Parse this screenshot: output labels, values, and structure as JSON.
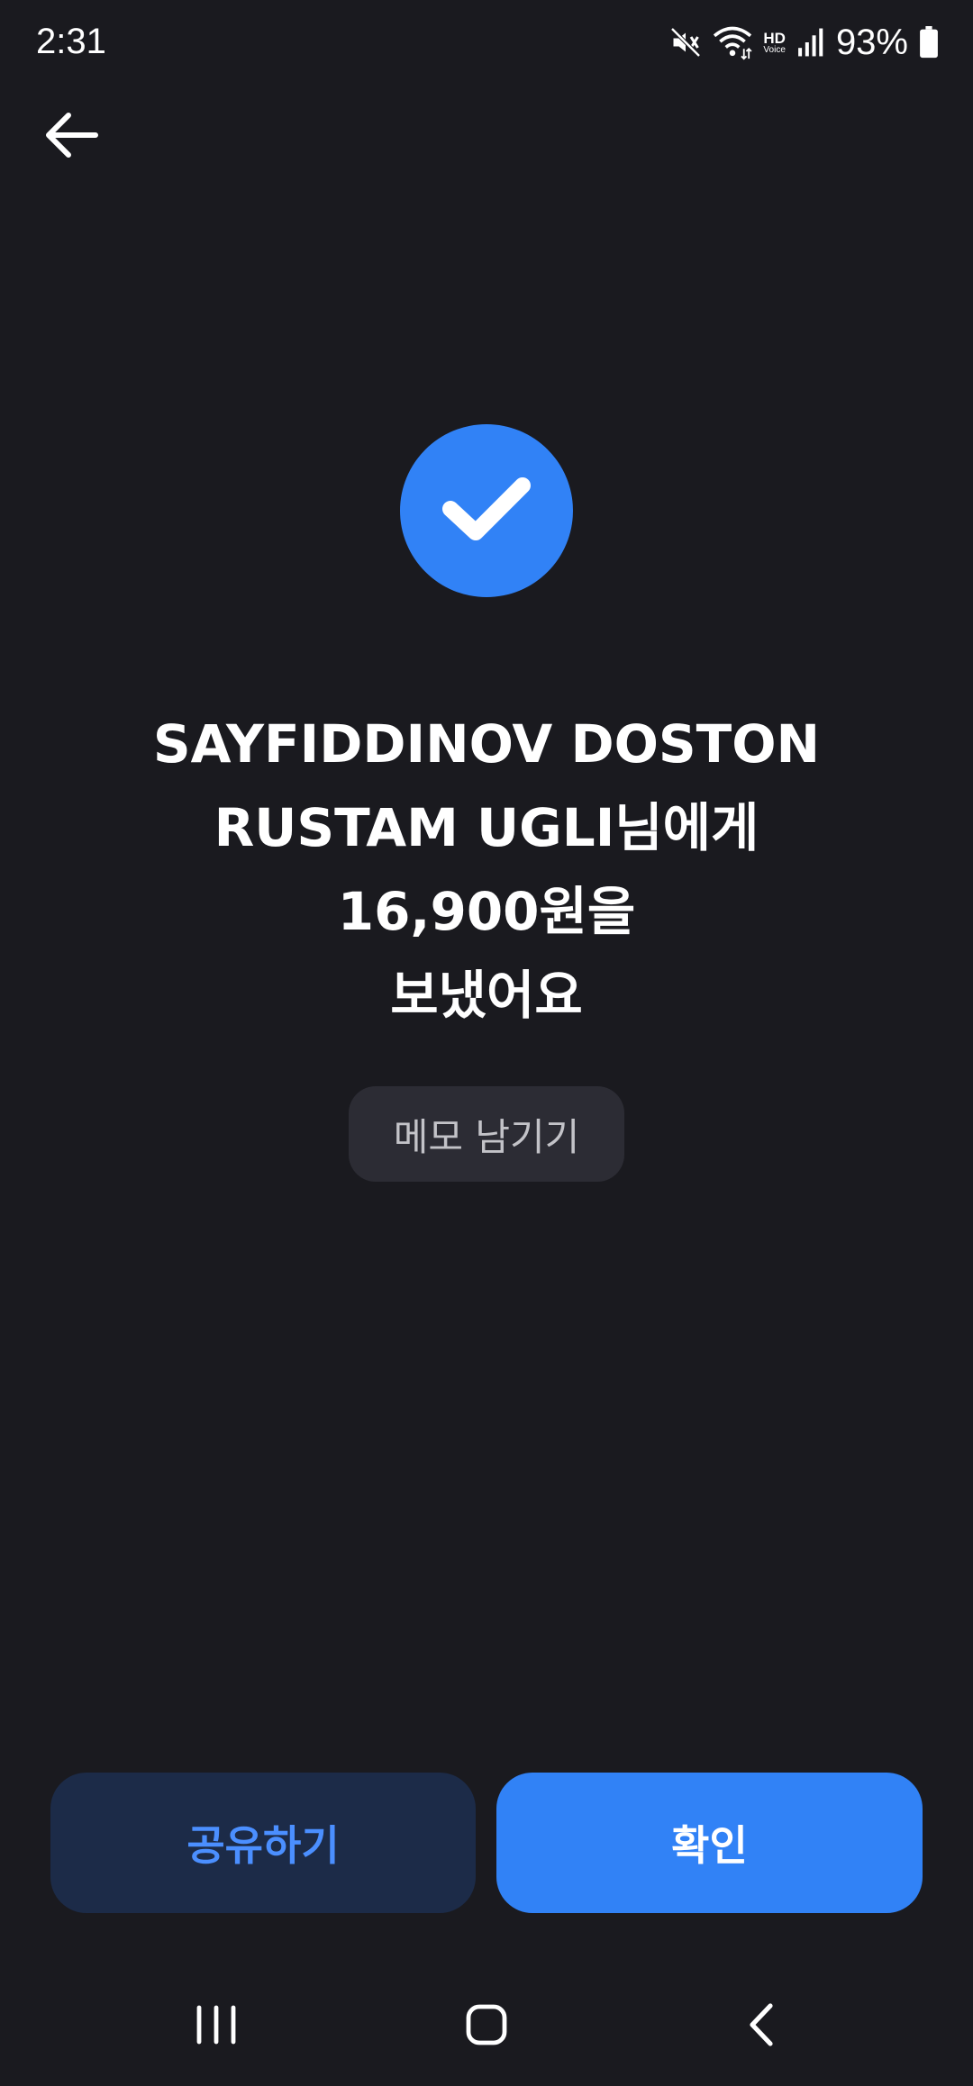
{
  "status_bar": {
    "time": "2:31",
    "hd_label": "HD",
    "voice_label": "Voice",
    "battery": "93%",
    "icons": [
      "mute-icon",
      "wifi-icon",
      "hd-voice-icon",
      "signal-icon",
      "battery-icon"
    ]
  },
  "header": {
    "back_icon": "arrow-left-icon"
  },
  "result": {
    "icon": "check-icon",
    "line1": "SAYFIDDINOV DOSTON",
    "line2": "RUSTAM UGLI님에게",
    "line3": "16,900원을",
    "line4": "보냈어요"
  },
  "memo_button_label": "메모 남기기",
  "actions": {
    "share_label": "공유하기",
    "confirm_label": "확인"
  },
  "colors": {
    "background": "#1a1a1f",
    "accent": "#3182f6",
    "share_bg": "#1c2b48",
    "share_text": "#4b8fff",
    "memo_bg": "#2c2c34"
  },
  "nav": {
    "icons": [
      "recent-apps-icon",
      "home-icon",
      "nav-back-icon"
    ]
  }
}
